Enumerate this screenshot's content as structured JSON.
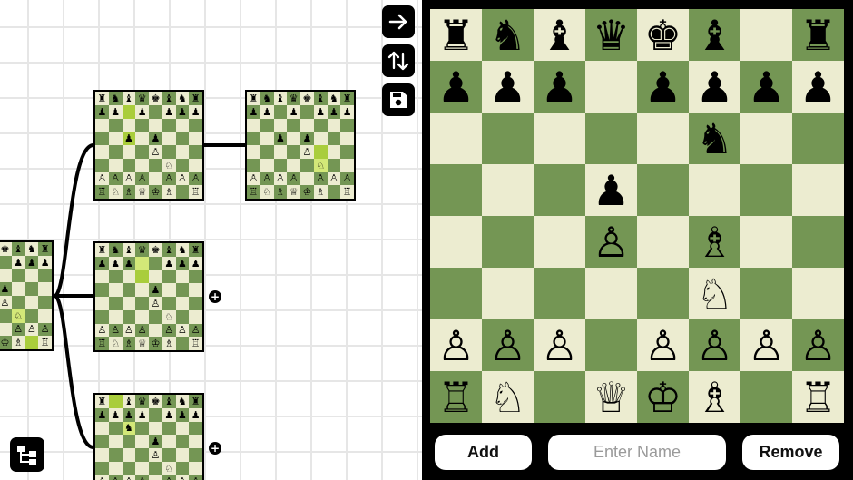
{
  "toolbar": {
    "next_icon": "arrow-right-icon",
    "flip_icon": "flip-vertical-arrows-icon",
    "save_icon": "save-disk-icon",
    "tree_icon": "tree-layout-icon"
  },
  "tree": {
    "add_glyph": "+",
    "nodes": [
      {
        "id": "node-root",
        "board": [
          [
            "♜",
            "♞",
            "♝",
            "♛",
            "♚",
            "♝",
            "♞",
            "♜"
          ],
          [
            "♟",
            "♟",
            "♟",
            "♟",
            "",
            "♟",
            "♟",
            "♟"
          ],
          [
            "",
            "",
            "",
            "",
            "",
            "",
            "",
            ""
          ],
          [
            "",
            "",
            "",
            "",
            "♟",
            "",
            "",
            ""
          ],
          [
            "",
            "",
            "",
            "",
            "♙",
            "",
            "",
            ""
          ],
          [
            "",
            "",
            "",
            "",
            "",
            "♘",
            "",
            ""
          ],
          [
            "♙",
            "♙",
            "♙",
            "♙",
            "",
            "♙",
            "♙",
            "♙"
          ],
          [
            "♖",
            "♘",
            "♗",
            "♕",
            "♔",
            "♗",
            "",
            "♖"
          ]
        ],
        "highlights": [
          [
            5,
            5
          ],
          [
            7,
            6
          ]
        ]
      },
      {
        "id": "node-a",
        "board": [
          [
            "♜",
            "♞",
            "♝",
            "♛",
            "♚",
            "♝",
            "♞",
            "♜"
          ],
          [
            "♟",
            "♟",
            "",
            "♟",
            "",
            "♟",
            "♟",
            "♟"
          ],
          [
            "",
            "",
            "",
            "",
            "",
            "",
            "",
            ""
          ],
          [
            "",
            "",
            "♟",
            "",
            "♟",
            "",
            "",
            ""
          ],
          [
            "",
            "",
            "",
            "",
            "♙",
            "",
            "",
            ""
          ],
          [
            "",
            "",
            "",
            "",
            "",
            "♘",
            "",
            ""
          ],
          [
            "♙",
            "♙",
            "♙",
            "♙",
            "",
            "♙",
            "♙",
            "♙"
          ],
          [
            "♖",
            "♘",
            "♗",
            "♕",
            "♔",
            "♗",
            "",
            "♖"
          ]
        ],
        "highlights": [
          [
            1,
            2
          ],
          [
            3,
            2
          ]
        ]
      },
      {
        "id": "node-a1",
        "board": [
          [
            "♜",
            "♞",
            "♝",
            "♛",
            "♚",
            "♝",
            "♞",
            "♜"
          ],
          [
            "♟",
            "♟",
            "",
            "♟",
            "",
            "♟",
            "♟",
            "♟"
          ],
          [
            "",
            "",
            "",
            "",
            "",
            "",
            "",
            ""
          ],
          [
            "",
            "",
            "♟",
            "",
            "♟",
            "",
            "",
            ""
          ],
          [
            "",
            "",
            "",
            "",
            "♙",
            "",
            "",
            ""
          ],
          [
            "",
            "",
            "",
            "",
            "",
            "♘",
            "",
            ""
          ],
          [
            "♙",
            "♙",
            "♙",
            "♙",
            "",
            "♙",
            "♙",
            "♙"
          ],
          [
            "♖",
            "♘",
            "♗",
            "♕",
            "♔",
            "♗",
            "",
            "♖"
          ]
        ],
        "highlights": [
          [
            4,
            5
          ],
          [
            5,
            5
          ]
        ]
      },
      {
        "id": "node-b",
        "board": [
          [
            "♜",
            "♞",
            "♝",
            "♛",
            "♚",
            "♝",
            "♞",
            "♜"
          ],
          [
            "♟",
            "♟",
            "♟",
            "",
            "",
            "♟",
            "♟",
            "♟"
          ],
          [
            "",
            "",
            "",
            "",
            "",
            "",
            "",
            ""
          ],
          [
            "",
            "",
            "",
            "",
            "♟",
            "",
            "",
            ""
          ],
          [
            "",
            "",
            "",
            "",
            "♙",
            "",
            "",
            ""
          ],
          [
            "",
            "",
            "",
            "",
            "",
            "♘",
            "",
            ""
          ],
          [
            "♙",
            "♙",
            "♙",
            "♙",
            "",
            "♙",
            "♙",
            "♙"
          ],
          [
            "♖",
            "♘",
            "♗",
            "♕",
            "♔",
            "♗",
            "",
            "♖"
          ]
        ],
        "highlights": [
          [
            1,
            3
          ],
          [
            2,
            3
          ]
        ]
      },
      {
        "id": "node-c",
        "board": [
          [
            "♜",
            "",
            "♝",
            "♛",
            "♚",
            "♝",
            "♞",
            "♜"
          ],
          [
            "♟",
            "♟",
            "♟",
            "♟",
            "",
            "♟",
            "♟",
            "♟"
          ],
          [
            "",
            "",
            "♞",
            "",
            "",
            "",
            "",
            ""
          ],
          [
            "",
            "",
            "",
            "",
            "♟",
            "",
            "",
            ""
          ],
          [
            "",
            "",
            "",
            "",
            "♙",
            "",
            "",
            ""
          ],
          [
            "",
            "",
            "",
            "",
            "",
            "♘",
            "",
            ""
          ],
          [
            "♙",
            "♙",
            "♙",
            "♙",
            "",
            "♙",
            "♙",
            "♙"
          ],
          [
            "♖",
            "♘",
            "♗",
            "♕",
            "♔",
            "♗",
            "",
            "♖"
          ]
        ],
        "highlights": [
          [
            0,
            1
          ],
          [
            2,
            2
          ]
        ]
      }
    ]
  },
  "main_board": {
    "squares": [
      [
        "♜",
        "♞",
        "♝",
        "♛",
        "♚",
        "♝",
        "",
        "♜"
      ],
      [
        "♟",
        "♟",
        "♟",
        "",
        "♟",
        "♟",
        "♟",
        "♟"
      ],
      [
        "",
        "",
        "",
        "",
        "",
        "♞",
        "",
        ""
      ],
      [
        "",
        "",
        "",
        "♟",
        "",
        "",
        "",
        ""
      ],
      [
        "",
        "",
        "",
        "♙",
        "",
        "♗",
        "",
        ""
      ],
      [
        "",
        "",
        "",
        "",
        "",
        "♘",
        "",
        ""
      ],
      [
        "♙",
        "♙",
        "♙",
        "",
        "♙",
        "♙",
        "♙",
        "♙"
      ],
      [
        "♖",
        "♘",
        "",
        "♕",
        "♔",
        "♗",
        "",
        "♖"
      ]
    ]
  },
  "controls": {
    "add_label": "Add",
    "name_placeholder": "Enter Name",
    "name_value": "",
    "remove_label": "Remove"
  }
}
